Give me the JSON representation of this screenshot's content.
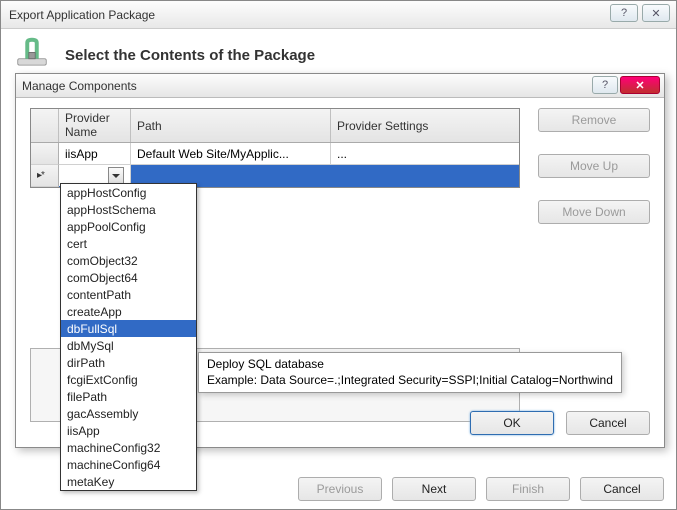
{
  "outer": {
    "title": "Export Application Package",
    "header": "Select the Contents of the Package",
    "buttons": {
      "previous": "Previous",
      "next": "Next",
      "finish": "Finish",
      "cancel": "Cancel"
    }
  },
  "inner": {
    "title": "Manage Components",
    "grid": {
      "columns": {
        "provider": "Provider Name",
        "path": "Path",
        "settings": "Provider Settings"
      },
      "row1": {
        "provider": "iisApp",
        "path": "Default Web Site/MyApplic...",
        "settings": "..."
      },
      "new_marker": "▸*"
    },
    "side": {
      "remove": "Remove",
      "moveUp": "Move Up",
      "moveDown": "Move Down"
    },
    "footer": {
      "ok": "OK",
      "cancel": "Cancel"
    }
  },
  "dropdown": {
    "items": {
      "0": "appHostConfig",
      "1": "appHostSchema",
      "2": "appPoolConfig",
      "3": "cert",
      "4": "comObject32",
      "5": "comObject64",
      "6": "contentPath",
      "7": "createApp",
      "8": "dbFullSql",
      "9": "dbMySql",
      "10": "dirPath",
      "11": "fcgiExtConfig",
      "12": "filePath",
      "13": "gacAssembly",
      "14": "iisApp",
      "15": "machineConfig32",
      "16": "machineConfig64",
      "17": "metaKey"
    },
    "selected_index": 8
  },
  "tooltip": {
    "line1": "Deploy SQL database",
    "line2": "Example: Data Source=.;Integrated Security=SSPI;Initial Catalog=Northwind"
  }
}
